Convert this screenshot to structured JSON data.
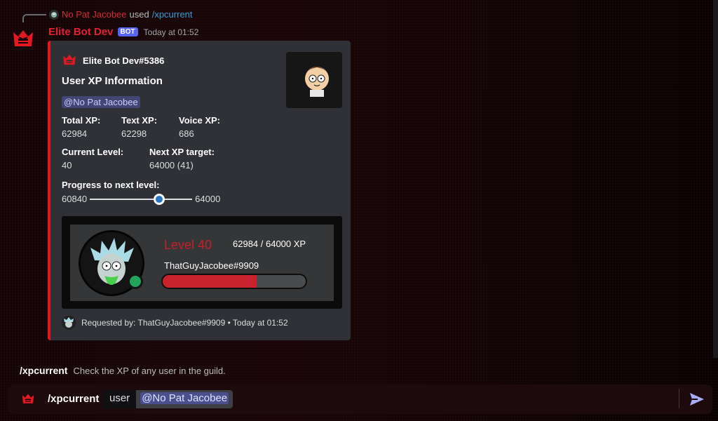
{
  "reply": {
    "user": "No Pat Jacobee",
    "used_text": "used",
    "command": "/xpcurrent"
  },
  "message": {
    "bot_name": "Elite Bot Dev",
    "bot_tag": "BOT",
    "timestamp": "Today at 01:52"
  },
  "embed": {
    "author": "Elite Bot Dev#5386",
    "title": "User XP Information",
    "mention": "@No Pat Jacobee",
    "fields": {
      "total_xp": {
        "name": "Total XP:",
        "value": "62984"
      },
      "text_xp": {
        "name": "Text XP:",
        "value": "62298"
      },
      "voice_xp": {
        "name": "Voice XP:",
        "value": "686"
      },
      "current_level": {
        "name": "Current Level:",
        "value": "40"
      },
      "next_target": {
        "name": "Next XP target:",
        "value": "64000 (41)"
      }
    },
    "progress": {
      "label": "Progress to next level:",
      "min": "60840",
      "max": "64000",
      "fraction": 0.679
    },
    "rank_card": {
      "level": "Level 40",
      "xp": "62984 / 64000 XP",
      "username": "ThatGuyJacobee#9909",
      "bar_fraction": 0.655
    },
    "footer": "Requested by: ThatGuyJacobee#9909 • Today at 01:52",
    "accent_color": "#e3161f"
  },
  "command_hint": {
    "command": "/xpcurrent",
    "description": "Check the XP of any user in the guild."
  },
  "input": {
    "command": "/xpcurrent",
    "option_name": "user",
    "option_value": "@No Pat Jacobee"
  },
  "icons": {
    "bot_avatar": "crown-icon",
    "send": "send-icon"
  }
}
